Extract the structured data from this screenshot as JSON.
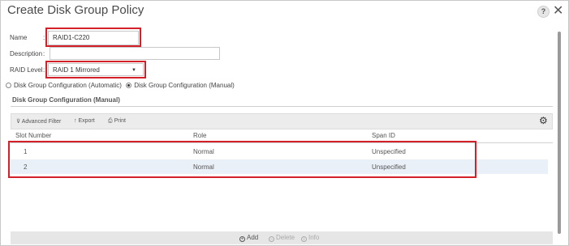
{
  "dialog": {
    "title": "Create Disk Group Policy",
    "help_label": "?",
    "close_label": "✕"
  },
  "form": {
    "name_label": "Name",
    "name_value": "RAID1-C220",
    "description_label": "Description",
    "description_value": "",
    "raid_label": "RAID Level",
    "raid_value": "RAID 1 Mirrored",
    "colon": ":"
  },
  "config": {
    "option_auto": "Disk Group Configuration (Automatic)",
    "option_manual": "Disk Group Configuration (Manual)",
    "selected": "manual",
    "section_title": "Disk Group Configuration (Manual)"
  },
  "toolbar": {
    "advanced_filter": "Advanced Filter",
    "export": "Export",
    "print": "Print"
  },
  "table": {
    "columns": [
      "Slot Number",
      "Role",
      "Span ID"
    ],
    "rows": [
      {
        "slot": "1",
        "role": "Normal",
        "span": "Unspecified"
      },
      {
        "slot": "2",
        "role": "Normal",
        "span": "Unspecified"
      }
    ]
  },
  "footer": {
    "add": "Add",
    "delete": "Delete",
    "info": "Info"
  },
  "colors": {
    "highlight": "#d32029"
  }
}
